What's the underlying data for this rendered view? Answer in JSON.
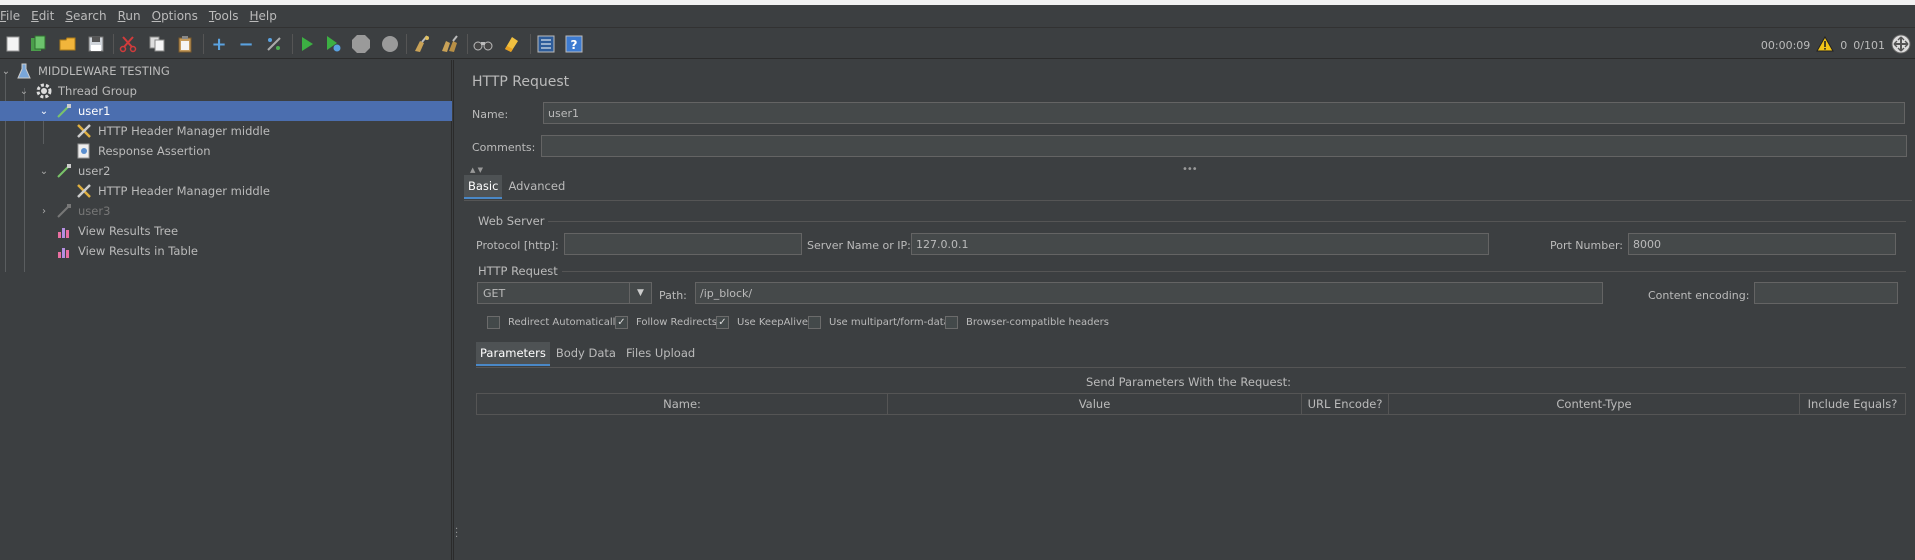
{
  "menu": [
    {
      "mnemonic": "F",
      "rest": "ile"
    },
    {
      "mnemonic": "E",
      "rest": "dit"
    },
    {
      "mnemonic": "S",
      "rest": "earch"
    },
    {
      "mnemonic": "R",
      "rest": "un"
    },
    {
      "mnemonic": "O",
      "rest": "ptions"
    },
    {
      "mnemonic": "T",
      "rest": "ools"
    },
    {
      "mnemonic": "H",
      "rest": "elp"
    }
  ],
  "toolbar": {
    "elapsed_time": "00:00:09",
    "warning_count": "0",
    "threads": "0/101"
  },
  "tree": {
    "items": [
      {
        "label": "MIDDLEWARE TESTING",
        "icon": "test-plan-icon"
      },
      {
        "label": "Thread Group",
        "icon": "gear-icon"
      },
      {
        "label": "user1",
        "icon": "sampler-pipette-icon"
      },
      {
        "label": "HTTP Header Manager middle",
        "icon": "tools-icon"
      },
      {
        "label": "Response Assertion",
        "icon": "assertion-icon"
      },
      {
        "label": "user2",
        "icon": "sampler-pipette-icon"
      },
      {
        "label": "HTTP Header Manager middle",
        "icon": "tools-icon"
      },
      {
        "label": "user3",
        "icon": "sampler-pipette-icon"
      },
      {
        "label": "View Results Tree",
        "icon": "chart-icon"
      },
      {
        "label": "View Results in Table",
        "icon": "chart-icon"
      }
    ]
  },
  "panel": {
    "title": "HTTP Request",
    "name_label": "Name:",
    "name_value": "user1",
    "comments_label": "Comments:",
    "comments_value": "",
    "tabs": [
      "Basic",
      "Advanced"
    ],
    "web_server": {
      "group_label": "Web Server",
      "protocol_label": "Protocol [http]:",
      "protocol_value": "",
      "server_label": "Server Name or IP:",
      "server_value": "127.0.0.1",
      "port_label": "Port Number:",
      "port_value": "8000"
    },
    "http_request": {
      "group_label": "HTTP Request",
      "method": "GET",
      "path_label": "Path:",
      "path_value": "/ip_block/",
      "encoding_label": "Content encoding:",
      "encoding_value": ""
    },
    "checkboxes": [
      {
        "label": "Redirect Automatically",
        "checked": false
      },
      {
        "label": "Follow Redirects",
        "checked": true
      },
      {
        "label": "Use KeepAlive",
        "checked": true
      },
      {
        "label": "Use multipart/form-data",
        "checked": false
      },
      {
        "label": "Browser-compatible headers",
        "checked": false
      }
    ],
    "sub_tabs": [
      "Parameters",
      "Body Data",
      "Files Upload"
    ],
    "params_title": "Send Parameters With the Request:",
    "columns": [
      "Name:",
      "Value",
      "URL Encode?",
      "Content-Type",
      "Include Equals?"
    ]
  },
  "colors": {
    "background": "#3c3f41",
    "selection": "#4b6eaf",
    "field": "#45494a"
  }
}
